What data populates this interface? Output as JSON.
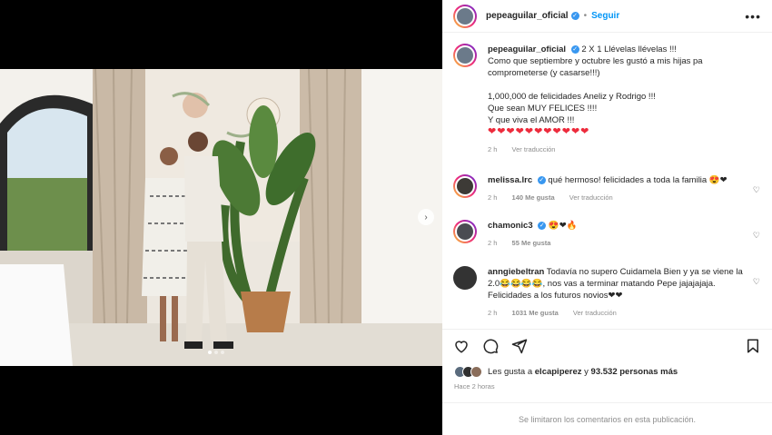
{
  "header": {
    "username": "pepeaguilar_oficial",
    "follow_label": "Seguir",
    "more_label": "•••"
  },
  "caption": {
    "username": "pepeaguilar_oficial",
    "line1": "2 X 1 Llévelas llévelas !!!",
    "line2": "Como que septiembre y octubre les gustó a mis hijas pa comprometerse (y casarse!!!)",
    "line3": "1,000,000 de felicidades Aneliz y Rodrigo !!!",
    "line4": "Que sean MUY FELICES !!!!",
    "line5": "Y que viva el AMOR !!!",
    "hearts": "❤❤❤❤❤❤❤❤❤❤❤",
    "time": "2 h",
    "translate": "Ver traducción"
  },
  "comments": [
    {
      "username": "melissa.lrc",
      "text": "qué hermoso! felicidades a toda la familia 😍❤",
      "time": "2 h",
      "likes": "140 Me gusta",
      "translate": "Ver traducción"
    },
    {
      "username": "chamonic3",
      "text": "😍❤🔥",
      "time": "2 h",
      "likes": "55 Me gusta"
    },
    {
      "username": "anngiebeltran",
      "text": "Todavía no supero Cuidamela Bien y ya se viene la 2.0😂😂😂😂, nos vas a terminar matando Pepe jajajajaja. Felicidades a los futuros novios❤❤",
      "time": "2 h",
      "likes": "1031 Me gusta",
      "translate": "Ver traducción"
    }
  ],
  "likes": {
    "prefix": "Les gusta a",
    "user": "elcapiperez",
    "middle": "y",
    "count": "93.532 personas más"
  },
  "post_time": "Hace 2 horas",
  "limited_text": "Se limitaron los comentarios en esta publicación.",
  "icons": {
    "like": "heart-icon",
    "comment": "comment-icon",
    "share": "share-icon",
    "save": "bookmark-icon",
    "next": "chevron-right-icon"
  },
  "colors": {
    "accent": "#0095f6",
    "verified": "#3897f0",
    "heart": "#ed2b3c"
  }
}
